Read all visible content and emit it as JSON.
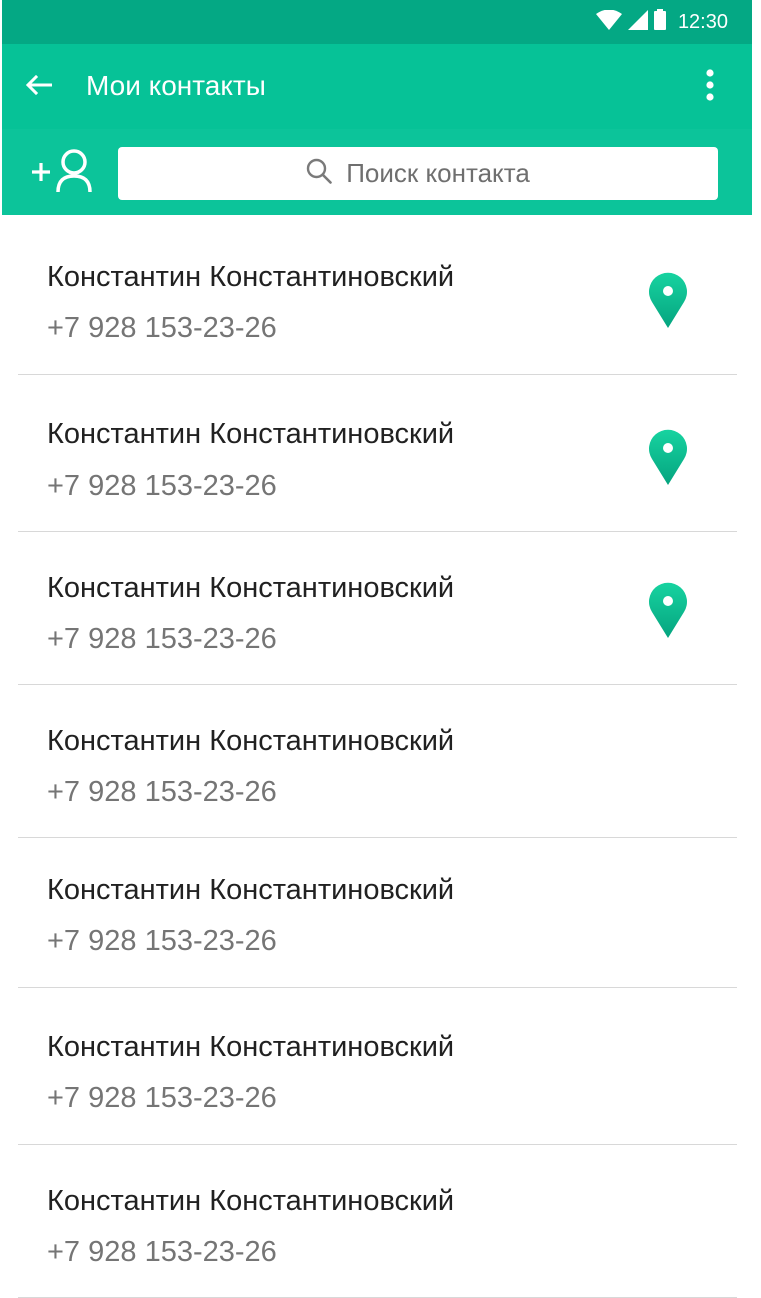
{
  "status_bar": {
    "time": "12:30",
    "icons": [
      "wifi-icon",
      "signal-icon",
      "battery-icon"
    ]
  },
  "app_bar": {
    "title": "Мои контакты",
    "back_icon": "arrow-back-icon",
    "menu_icon": "more-vert-icon"
  },
  "search": {
    "placeholder": "Поиск контакта",
    "add_contact_icon": "add-person-icon"
  },
  "contacts": [
    {
      "name": "Константин Константиновский",
      "phone": "+7 928 153-23-26",
      "has_location": true
    },
    {
      "name": "Константин Константиновский",
      "phone": "+7 928 153-23-26",
      "has_location": true
    },
    {
      "name": "Константин Константиновский",
      "phone": "+7 928 153-23-26",
      "has_location": true
    },
    {
      "name": "Константин Константиновский",
      "phone": "+7 928 153-23-26",
      "has_location": false
    },
    {
      "name": "Константин Константиновский",
      "phone": "+7 928 153-23-26",
      "has_location": false
    },
    {
      "name": "Константин Константиновский",
      "phone": "+7 928 153-23-26",
      "has_location": false
    },
    {
      "name": "Константин Константиновский",
      "phone": "+7 928 153-23-26",
      "has_location": false
    }
  ],
  "colors": {
    "status_bar": "#04a884",
    "app_bar": "#06c297",
    "accent": "#0bc79a",
    "pin_top": "#17d3a0",
    "pin_bottom": "#05a47f",
    "divider": "#d8d8d8",
    "name_text": "#212121",
    "phone_text": "#757575"
  }
}
